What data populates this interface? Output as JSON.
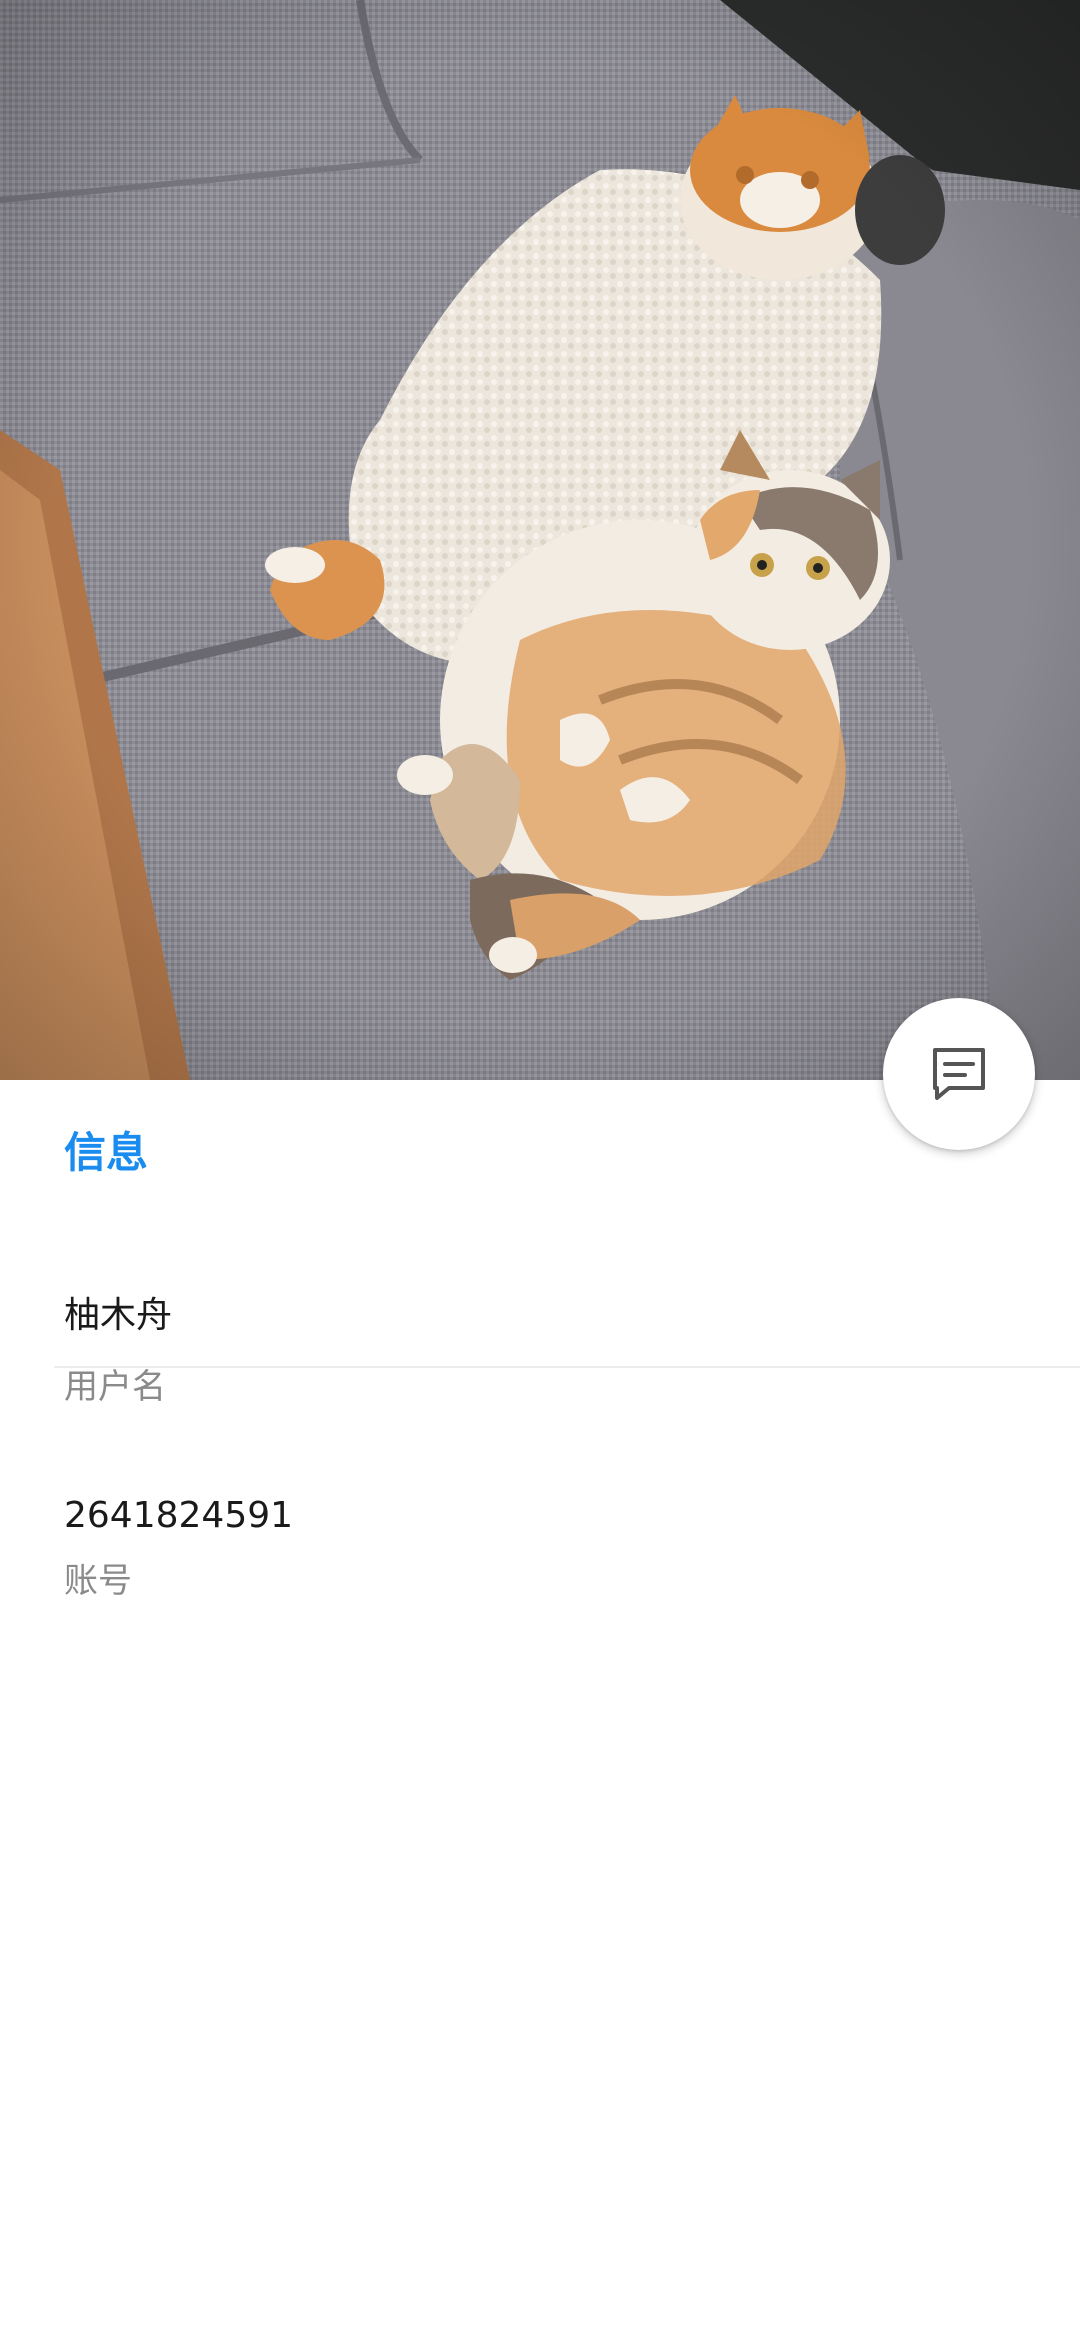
{
  "header": {
    "photo_description_icon": "cats-on-sofa-photo"
  },
  "fab": {
    "icon": "message-icon"
  },
  "info": {
    "title": "信息",
    "rows": [
      {
        "value": "柚木舟",
        "label": "用户名"
      },
      {
        "value": "2641824591",
        "label": "账号"
      }
    ]
  },
  "colors": {
    "accent": "#1a8cf0",
    "primary_text": "#1a1a1a",
    "secondary_text": "#8a8a8a"
  }
}
